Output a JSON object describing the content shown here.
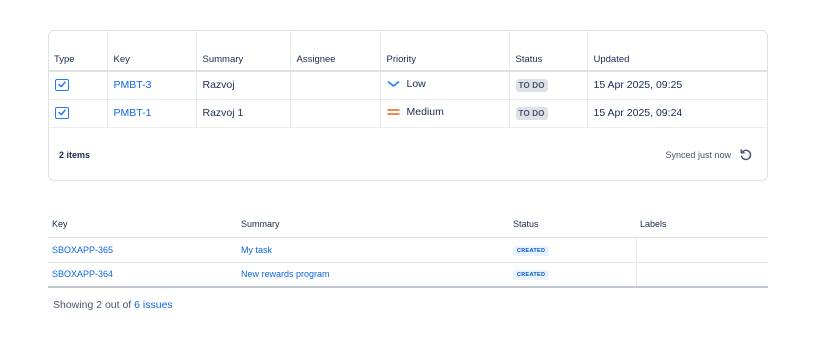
{
  "jira_table": {
    "headers": {
      "type": "Type",
      "key": "Key",
      "summary": "Summary",
      "assignee": "Assignee",
      "priority": "Priority",
      "status": "Status",
      "updated": "Updated"
    },
    "rows": [
      {
        "type_icon": "task-checkbox-icon",
        "key": "PMBT-3",
        "summary": "Razvoj",
        "assignee": "",
        "priority": "Low",
        "priority_icon": "priority-low-icon",
        "status": "TO DO",
        "updated": "15 Apr 2025, 09:25"
      },
      {
        "type_icon": "task-checkbox-icon",
        "key": "PMBT-1",
        "summary": "Razvoj 1",
        "assignee": "",
        "priority": "Medium",
        "priority_icon": "priority-medium-icon",
        "status": "TO DO",
        "updated": "15 Apr 2025, 09:24"
      }
    ],
    "footer": {
      "count": "2 items",
      "sync_status": "Synced just now",
      "refresh_icon": "refresh-icon"
    }
  },
  "issues_table": {
    "headers": {
      "key": "Key",
      "summary": "Summary",
      "status": "Status",
      "labels": "Labels"
    },
    "rows": [
      {
        "key": "SBOXAPP-365",
        "summary": "My task",
        "status": "CREATED",
        "labels": ""
      },
      {
        "key": "SBOXAPP-364",
        "summary": "New rewards program",
        "status": "CREATED",
        "labels": ""
      }
    ],
    "footer": {
      "prefix": "Showing 2 out of ",
      "link": "6 issues"
    }
  },
  "colors": {
    "link": "#0c66e4",
    "task_icon": "#1d7afc",
    "priority_low": "#1d7afc",
    "priority_medium": "#e56910",
    "todo_lozenge_bg": "#dfe1e6",
    "created_lozenge_bg": "#e9f2ff"
  }
}
